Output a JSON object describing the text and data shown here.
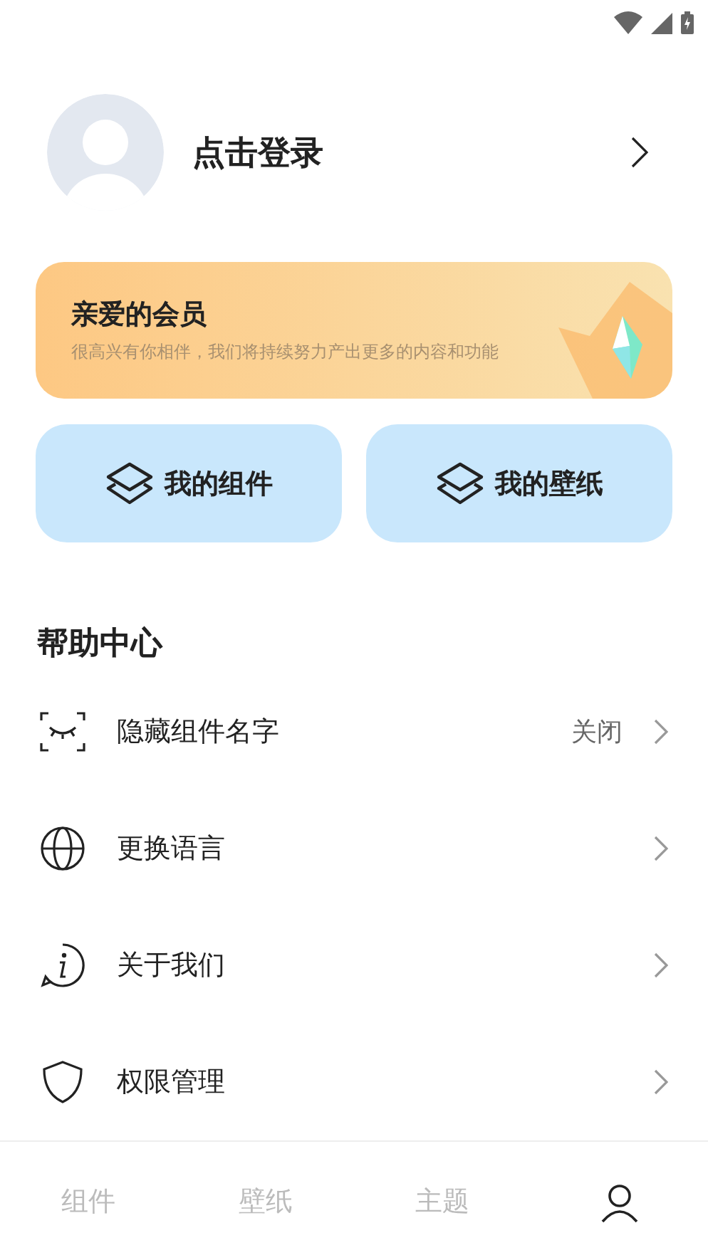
{
  "profile": {
    "name": "点击登录"
  },
  "member": {
    "title": "亲爱的会员",
    "subtitle": "很高兴有你相伴，我们将持续努力产出更多的内容和功能"
  },
  "shortcuts": [
    {
      "label": "我的组件"
    },
    {
      "label": "我的壁纸"
    }
  ],
  "help": {
    "title": "帮助中心",
    "items": [
      {
        "kind": "eye",
        "label": "隐藏组件名字",
        "value": "关闭"
      },
      {
        "kind": "globe",
        "label": "更换语言"
      },
      {
        "kind": "info",
        "label": "关于我们"
      },
      {
        "kind": "shield",
        "label": "权限管理"
      }
    ]
  },
  "tabs": [
    {
      "label": "组件",
      "selected": false
    },
    {
      "label": "壁纸",
      "selected": false
    },
    {
      "label": "主题",
      "selected": false
    },
    {
      "kind": "icon",
      "selected": true
    }
  ]
}
